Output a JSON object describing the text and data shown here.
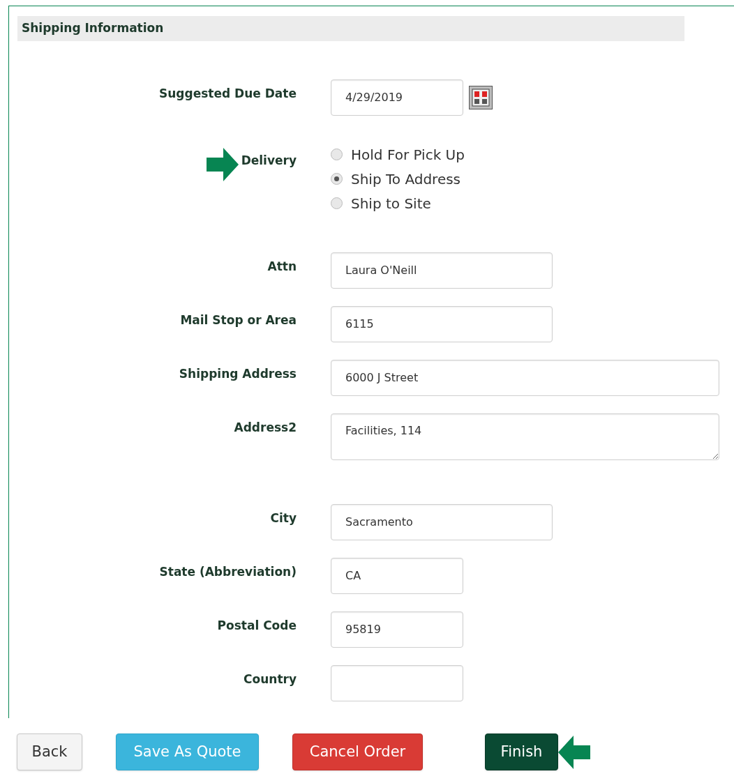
{
  "section": {
    "title": "Shipping Information"
  },
  "fields": [
    {
      "kind": "date",
      "label": "Suggested Due Date",
      "value": "4/29/2019",
      "pointer_arrow": false
    },
    {
      "kind": "radio",
      "label": "Delivery",
      "pointer_arrow": true,
      "options": [
        {
          "label": "Hold For Pick Up",
          "selected": false
        },
        {
          "label": "Ship To Address",
          "selected": true
        },
        {
          "label": "Ship to Site",
          "selected": false
        }
      ]
    },
    {
      "kind": "text",
      "label": "Attn",
      "value": "Laura O'Neill",
      "pointer_arrow": false
    },
    {
      "kind": "text",
      "label": "Mail Stop or Area",
      "value": "6115",
      "pointer_arrow": false
    },
    {
      "kind": "text",
      "label": "Shipping Address",
      "value": "6000 J Street",
      "pointer_arrow": false
    },
    {
      "kind": "textarea",
      "label": "Address2",
      "value": "Facilities, 114",
      "pointer_arrow": false
    },
    {
      "kind": "text",
      "label": "City",
      "value": "Sacramento",
      "pointer_arrow": false
    },
    {
      "kind": "text",
      "label": "State (Abbreviation)",
      "value": "CA",
      "pointer_arrow": false
    },
    {
      "kind": "text",
      "label": "Postal Code",
      "value": "95819",
      "pointer_arrow": false
    },
    {
      "kind": "text",
      "label": "Country",
      "pointer_arrow": false
    }
  ],
  "buttons": [
    {
      "label": "Back",
      "pointer_arrow": false
    },
    {
      "label": "Save As Quote",
      "pointer_arrow": false
    },
    {
      "label": "Cancel Order",
      "pointer_arrow": false
    },
    {
      "label": "Finish",
      "pointer_arrow": true
    }
  ]
}
